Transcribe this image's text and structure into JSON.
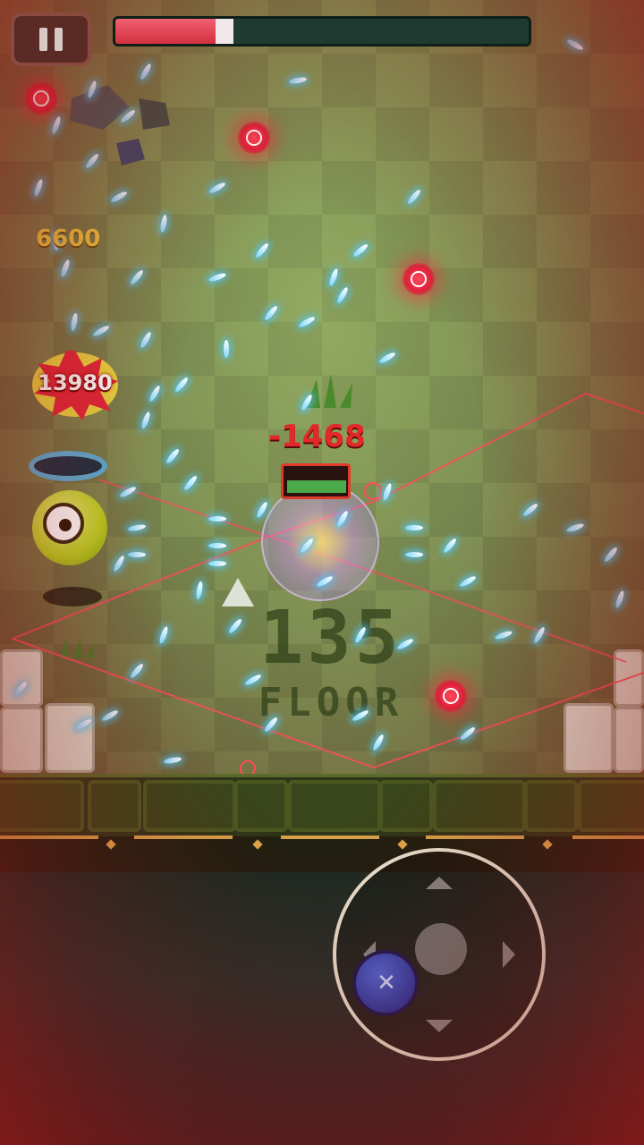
{
  "hud": {
    "pause_icon": "pause-icon",
    "health_fraction": 0.25,
    "health_color": "#e8374b"
  },
  "floating_text": {
    "coin_value": "6600",
    "burst_damage": "13980",
    "hit_damage": "-1468"
  },
  "floor": {
    "number": "135",
    "label": "FLOOR"
  },
  "controls": {
    "joystick_icon": "joystick-icon",
    "knob_icon_glyph": "✕"
  },
  "colors": {
    "accent_red": "#e22828",
    "bullet_cyan": "#7fd8ff",
    "coin_gold": "#e8c840"
  }
}
